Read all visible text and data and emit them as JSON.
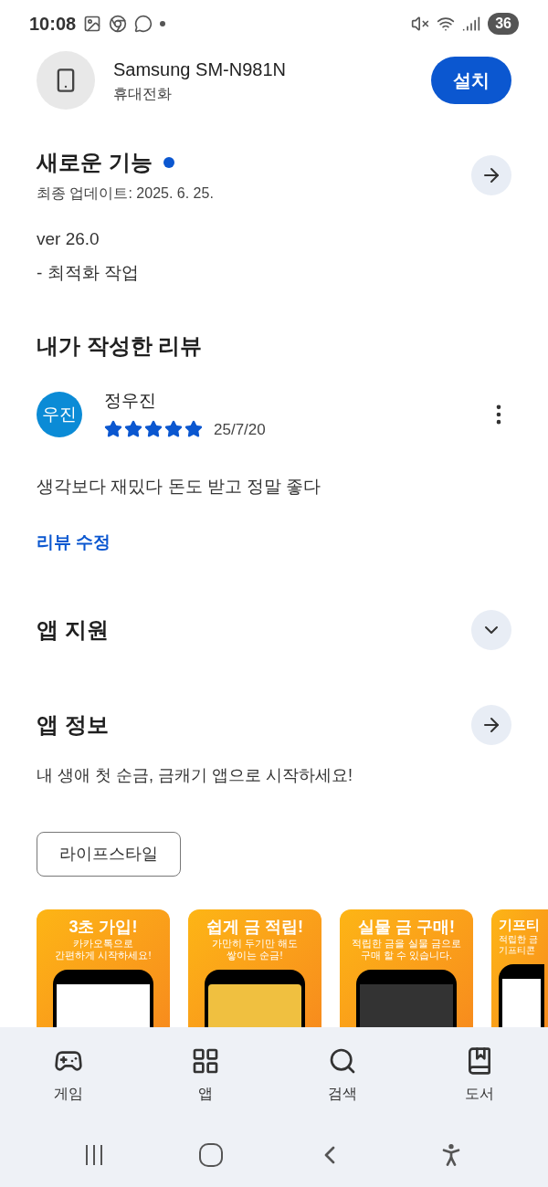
{
  "status_bar": {
    "time": "10:08",
    "battery": "36"
  },
  "device": {
    "name": "Samsung SM-N981N",
    "type": "휴대전화",
    "install_button": "설치"
  },
  "whats_new": {
    "title": "새로운 기능",
    "updated": "최종 업데이트: 2025. 6. 25.",
    "lines": [
      "ver 26.0",
      "- 최적화 작업"
    ]
  },
  "my_review": {
    "title": "내가 작성한 리뷰",
    "avatar": "우진",
    "author": "정우진",
    "stars": 5,
    "date": "25/7/20",
    "text": "생각보다 재밌다 돈도 받고 정말 좋다",
    "edit_link": "리뷰 수정"
  },
  "app_support": {
    "title": "앱 지원",
    "expanded": false
  },
  "app_info": {
    "title": "앱 정보",
    "description": "내 생애 첫 순금, 금캐기 앱으로 시작하세요!",
    "tag": "라이프스타일"
  },
  "screenshots": [
    {
      "title": "3초 가입!",
      "lines": [
        "카카오톡으로",
        "간편하게 시작하세요!"
      ]
    },
    {
      "title": "쉽게 금 적립!",
      "lines": [
        "가만히 두기만 해도",
        "쌓이는 순금!"
      ]
    },
    {
      "title": "실물 금 구매!",
      "lines": [
        "적립한 금을 실물 금으로",
        "구매 할 수 있습니다."
      ]
    },
    {
      "title": "기프티",
      "lines": [
        "적립한 금",
        "기프티콘"
      ]
    }
  ],
  "bottom_nav": [
    {
      "label": "게임",
      "selected": false
    },
    {
      "label": "앱",
      "selected": false
    },
    {
      "label": "검색",
      "selected": false
    },
    {
      "label": "도서",
      "selected": false
    }
  ]
}
